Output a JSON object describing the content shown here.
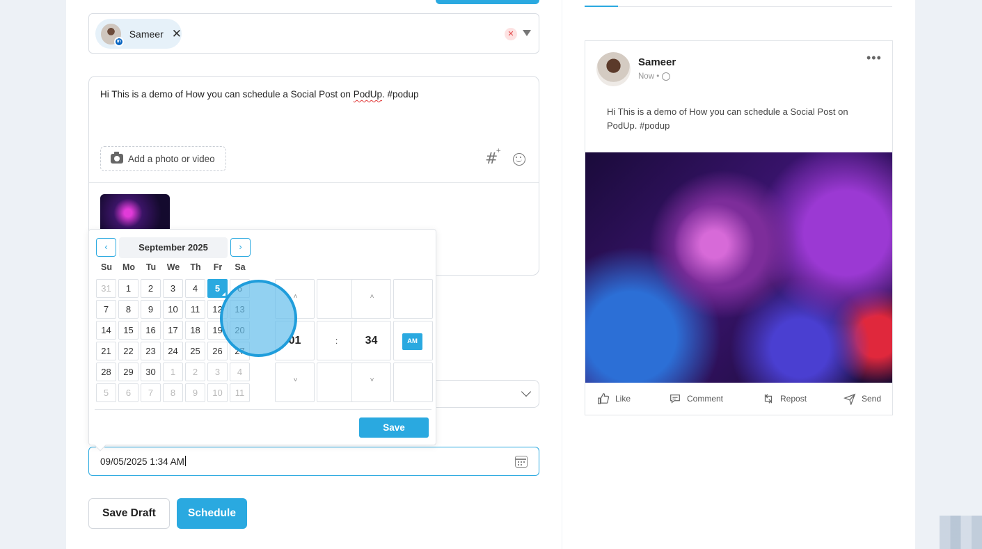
{
  "account": {
    "name": "Sameer",
    "network_badge": "in",
    "remove_glyph": "✕",
    "clear_glyph": "✕"
  },
  "editor": {
    "post_text_before": "Hi This is a demo of How you can schedule a Social Post on ",
    "post_text_misspelled": "PodUp",
    "post_text_after": ". #podup",
    "add_media_label": "Add a photo or video",
    "hashtag_glyph": "#",
    "hashtag_spark": "+"
  },
  "datepicker": {
    "month_label": "September 2025",
    "prev_glyph": "‹",
    "next_glyph": "›",
    "weekdays": [
      "Su",
      "Mo",
      "Tu",
      "We",
      "Th",
      "Fr",
      "Sa"
    ],
    "weeks": [
      [
        "31",
        "1",
        "2",
        "3",
        "4",
        "5",
        "6"
      ],
      [
        "7",
        "8",
        "9",
        "10",
        "11",
        "12",
        "13"
      ],
      [
        "14",
        "15",
        "16",
        "17",
        "18",
        "19",
        "20"
      ],
      [
        "21",
        "22",
        "23",
        "24",
        "25",
        "26",
        "27"
      ],
      [
        "28",
        "29",
        "30",
        "1",
        "2",
        "3",
        "4"
      ],
      [
        "5",
        "6",
        "7",
        "8",
        "9",
        "10",
        "11"
      ]
    ],
    "selected_day": "5",
    "hour": "01",
    "separator": ":",
    "minute": "34",
    "meridiem": "AM",
    "up_glyph": "˄",
    "down_glyph": "˅",
    "save_label": "Save"
  },
  "schedule": {
    "date_value": "09/05/2025 1:34 AM"
  },
  "buttons": {
    "save_draft": "Save Draft",
    "schedule": "Schedule"
  },
  "preview": {
    "author": "Sameer",
    "meta": "Now •",
    "more_glyph": "•••",
    "text": "Hi This is a demo of How you can schedule a Social Post on PodUp. #podup",
    "actions": {
      "like": "Like",
      "comment": "Comment",
      "repost": "Repost",
      "send": "Send"
    }
  },
  "colors": {
    "accent": "#2aa9e0",
    "linkedin": "#0a66c2",
    "danger": "#e24b4b"
  }
}
